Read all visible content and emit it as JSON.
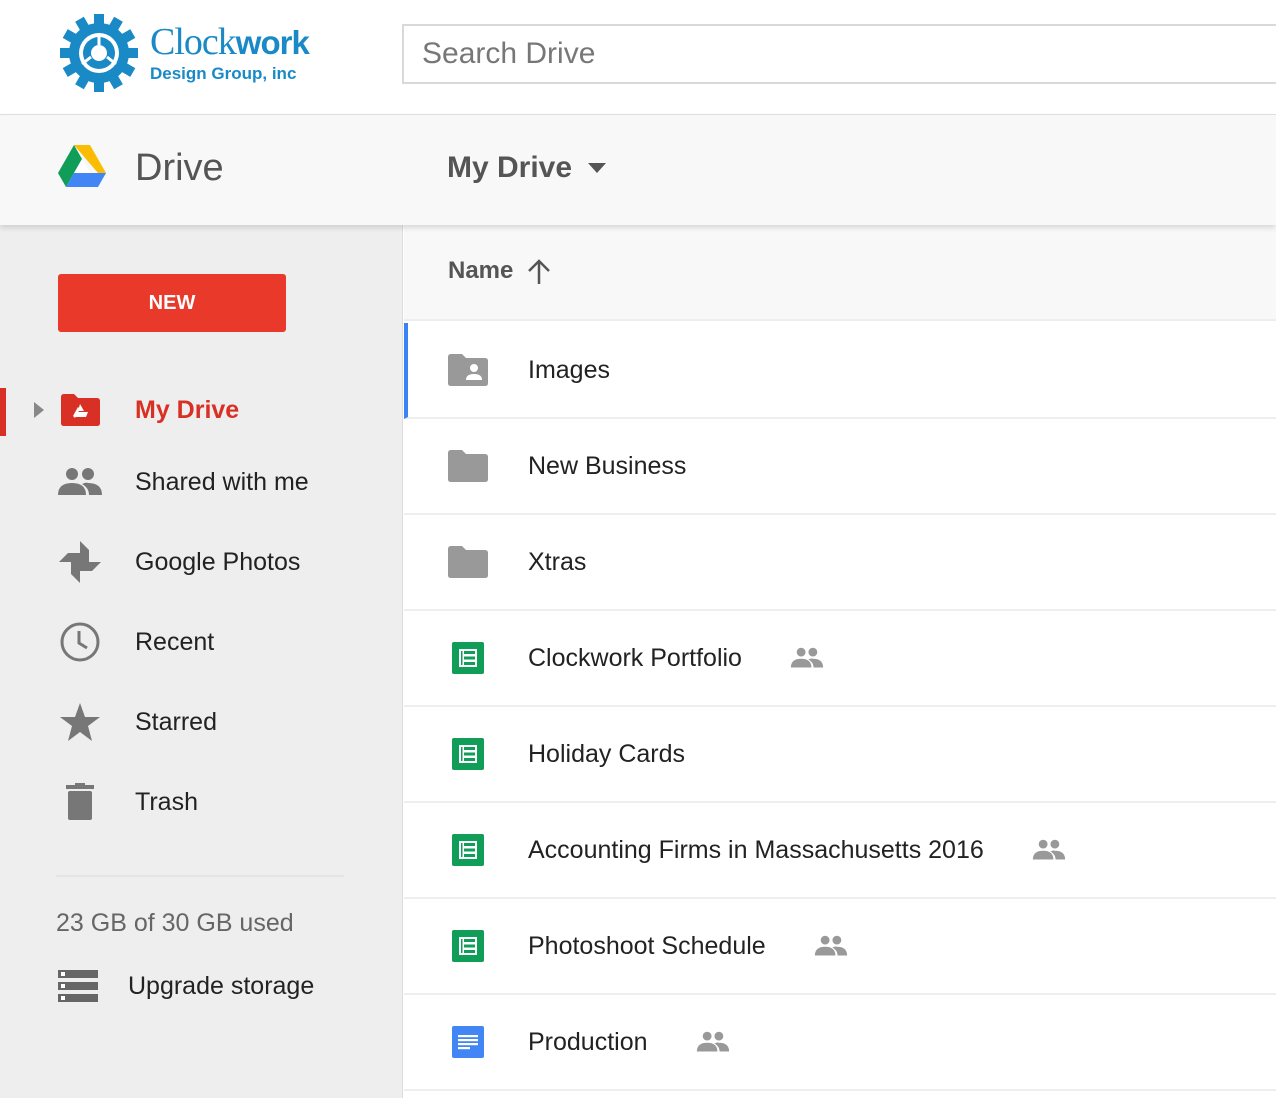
{
  "topbar": {
    "logo": {
      "line1_light": "Clock",
      "line1_bold": "work",
      "line2": "Design Group, inc"
    },
    "search": {
      "placeholder": "Search Drive",
      "value": ""
    }
  },
  "appbar": {
    "app_name": "Drive",
    "breadcrumb": "My Drive"
  },
  "sidebar": {
    "new_label": "NEW",
    "items": [
      {
        "label": "My Drive",
        "icon": "my-drive-folder-icon",
        "active": true
      },
      {
        "label": "Shared with me",
        "icon": "people-icon",
        "active": false
      },
      {
        "label": "Google Photos",
        "icon": "pinwheel-icon",
        "active": false
      },
      {
        "label": "Recent",
        "icon": "clock-icon",
        "active": false
      },
      {
        "label": "Starred",
        "icon": "star-icon",
        "active": false
      },
      {
        "label": "Trash",
        "icon": "trash-icon",
        "active": false
      }
    ],
    "storage_text": "23 GB of 30 GB used",
    "storage_used_gb": 23,
    "storage_total_gb": 30,
    "upgrade_label": "Upgrade storage"
  },
  "list": {
    "sort_column": "Name",
    "sort_direction": "ascending",
    "files": [
      {
        "name": "Images",
        "type": "shared-folder",
        "shared": false,
        "selected": true
      },
      {
        "name": "New Business",
        "type": "folder",
        "shared": false,
        "selected": false
      },
      {
        "name": "Xtras",
        "type": "folder",
        "shared": false,
        "selected": false
      },
      {
        "name": "Clockwork Portfolio",
        "type": "spreadsheet",
        "shared": true,
        "selected": false
      },
      {
        "name": "Holiday Cards",
        "type": "spreadsheet",
        "shared": false,
        "selected": false
      },
      {
        "name": "Accounting Firms in Massachusetts 2016",
        "type": "spreadsheet",
        "shared": true,
        "selected": false
      },
      {
        "name": "Photoshoot Schedule",
        "type": "spreadsheet",
        "shared": true,
        "selected": false
      },
      {
        "name": "Production",
        "type": "document",
        "shared": true,
        "selected": false
      }
    ]
  },
  "colors": {
    "brand_blue": "#1a8ac6",
    "new_button": "#e8392a",
    "active_red": "#d93025",
    "selection_blue": "#3b82f6",
    "sheets_green": "#0f9d58",
    "docs_blue": "#4285f4",
    "icon_gray": "#777777"
  }
}
